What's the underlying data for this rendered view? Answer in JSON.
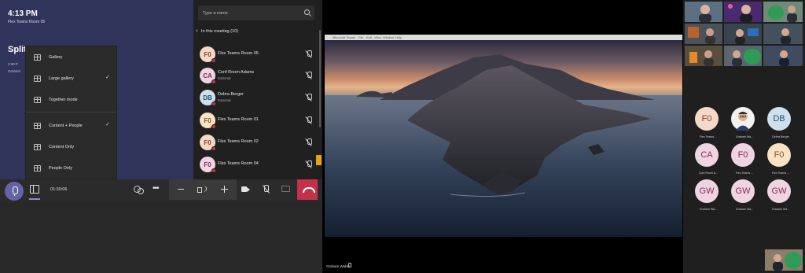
{
  "colors": {
    "accent": "#6264a7",
    "hangup": "#c4314b",
    "panel_bg": "#202020",
    "avatar_peach": "#f5d9c8",
    "avatar_peach_text": "#8a3a2a",
    "avatar_pink": "#efd4e2",
    "avatar_pink_text": "#8a2a58",
    "avatar_blue": "#cfe0ec",
    "avatar_blue_text": "#23506e",
    "avatar_gold": "#f8e3c2",
    "avatar_gold_text": "#80562a"
  },
  "header": {
    "time": "4:13 PM",
    "room": "Flex Teams Room 05"
  },
  "meeting_card": {
    "title": "Split",
    "time": "2:30 P",
    "organizer": "Graham"
  },
  "view_menu": {
    "items": [
      {
        "label": "Gallery",
        "icon": "grid-icon",
        "checked": ""
      },
      {
        "label": "Large gallery",
        "icon": "large-gallery-icon",
        "checked": "✓"
      },
      {
        "label": "Together mode",
        "icon": "together-mode-icon",
        "checked": ""
      },
      {
        "label": "Content + People",
        "icon": "content-people-icon",
        "checked": "✓"
      },
      {
        "label": "Content Only",
        "icon": "content-only-icon",
        "checked": ""
      },
      {
        "label": "People Only",
        "icon": "people-only-icon",
        "checked": ""
      }
    ]
  },
  "participants": {
    "search_placeholder": "Type a name",
    "section_label": "In this meeting (10)",
    "list": [
      {
        "initials": "F0",
        "name": "Flex Teams Room 05",
        "sub": "",
        "mic": "mic-off-icon"
      },
      {
        "initials": "CA",
        "name": "Conf Room Adams",
        "sub": "External",
        "mic": "mic-off-icon"
      },
      {
        "initials": "DB",
        "name": "Debra Berger",
        "sub": "External",
        "mic": "mic-off-icon"
      },
      {
        "initials": "F0",
        "name": "Flex Teams Room 01",
        "sub": "",
        "mic": "mic-off-icon"
      },
      {
        "initials": "F0",
        "name": "Flex Teams Room 02",
        "sub": "",
        "mic": "mic-off-icon"
      },
      {
        "initials": "F0",
        "name": "Flex Teams Room 04",
        "sub": "",
        "mic": "mic-off-icon"
      }
    ]
  },
  "controls": {
    "timer": "01:30:06",
    "more": "•••"
  },
  "stage": {
    "mac_menu": [
      "Microsoft Teams",
      "File",
      "Edit",
      "View",
      "Window",
      "Help"
    ],
    "presenter": "Graham Walsh"
  },
  "gallery": {
    "tiles": [
      {
        "initials": "F0",
        "name": "Flex Teams ..."
      },
      {
        "initials": "",
        "name": "Graham Wa..."
      },
      {
        "initials": "DB",
        "name": "Debra Berger"
      },
      {
        "initials": "CA",
        "name": "Conf Room A..."
      },
      {
        "initials": "F0",
        "name": "Flex Teams ..."
      },
      {
        "initials": "F0",
        "name": "Flex Teams ..."
      },
      {
        "initials": "GW",
        "name": "Graham Wa..."
      },
      {
        "initials": "GW",
        "name": "Graham Wa..."
      },
      {
        "initials": "GW",
        "name": "Graham Wa..."
      }
    ]
  }
}
